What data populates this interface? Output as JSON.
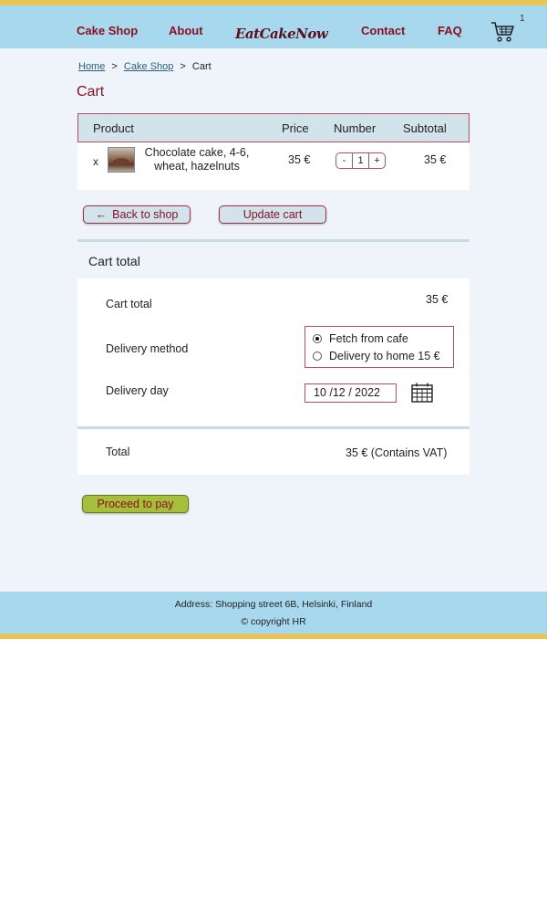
{
  "header": {
    "nav": [
      "Cake Shop",
      "About",
      "Contact",
      "FAQ"
    ],
    "logo": "EatCakeNow",
    "cart_count": "1"
  },
  "breadcrumb": {
    "home": "Home",
    "sep1": ">",
    "shop": "Cake Shop",
    "sep2": ">",
    "current": "Cart"
  },
  "page_title": "Cart",
  "cart_table": {
    "headers": [
      "Product",
      "Price",
      "Number",
      "Subtotal"
    ],
    "rows": [
      {
        "remove": "x",
        "name": "Chocolate cake, 4-6, wheat, hazelnuts",
        "price": "35 €",
        "qty_minus": "-",
        "qty": "1",
        "qty_plus": "+",
        "subtotal": "35 €"
      }
    ]
  },
  "buttons": {
    "back_arrow": "←",
    "back": "Back to shop",
    "update": "Update cart",
    "pay": "Proceed to pay"
  },
  "totals": {
    "title": "Cart total",
    "cart_total_label": "Cart total",
    "cart_total_value": "35 €",
    "delivery_label": "Delivery method",
    "delivery_options": [
      "Fetch from cafe",
      "Delivery to home 15 €"
    ],
    "delivery_selected": 0,
    "day_label": "Delivery day",
    "day_value": "10 /12 / 2022",
    "total_label": "Total",
    "total_value": "35 € (Contains VAT)"
  },
  "footer": {
    "address": "Address: Shopping street 6B, Helsinki, Finland",
    "copyright": "© copyright HR"
  },
  "colors": {
    "header_bg": "#a8d8ee",
    "accent_bar": "#e8c557",
    "brand_text": "#8a1020",
    "pay_button": "#a6be3a"
  },
  "icons": {
    "cart": "shopping-cart-icon",
    "calendar": "calendar-icon",
    "back": "arrow-left-icon"
  }
}
